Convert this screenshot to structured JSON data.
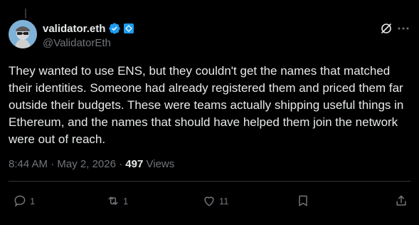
{
  "author": {
    "display_name": "validator.eth",
    "handle": "@ValidatorEth"
  },
  "post": {
    "text": "They wanted to use ENS, but they couldn't get the names that matched their identities. Someone had already registered them and priced them far outside their budgets. These were teams actually shipping useful things in Ethereum, and the names that should have helped them join the network were out of reach."
  },
  "meta": {
    "time": "8:44 AM",
    "separator": "·",
    "date": "May 2, 2026",
    "views_count": "497",
    "views_label": "Views"
  },
  "actions": {
    "replies": "1",
    "reposts": "1",
    "likes": "11"
  },
  "colors": {
    "background": "#000000",
    "text": "#e7e9ea",
    "secondary": "#71767b",
    "verified": "#1d9bf0"
  },
  "icons": [
    "verified-badge-icon",
    "affiliation-icon",
    "grok-icon",
    "more-icon",
    "reply-icon",
    "repost-icon",
    "like-icon",
    "bookmark-icon",
    "share-icon"
  ]
}
